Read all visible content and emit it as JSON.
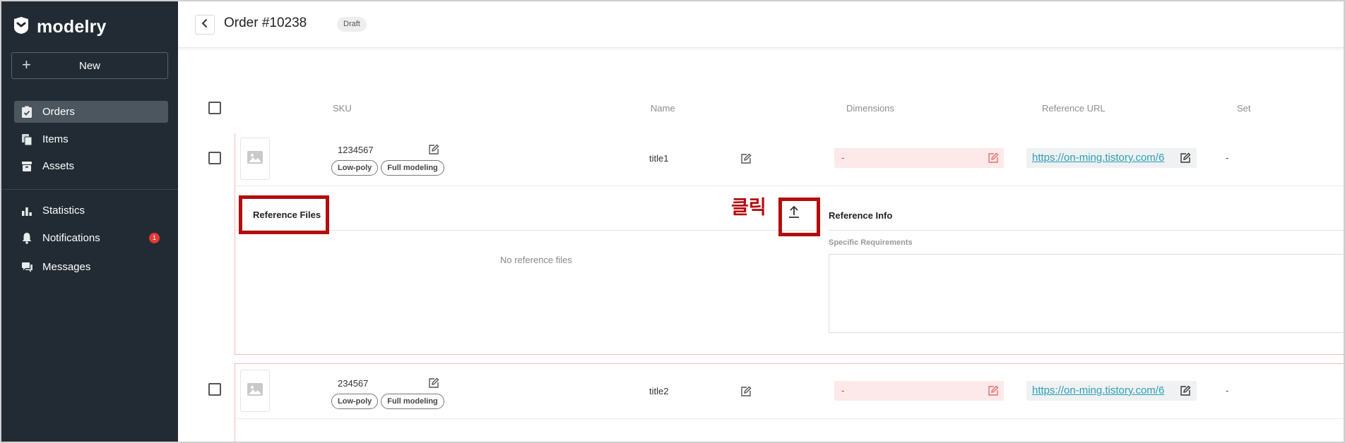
{
  "app": {
    "name": "modelry"
  },
  "sidebar": {
    "new_label": "New",
    "items": [
      {
        "label": "Orders",
        "icon": "orders-icon",
        "active": true
      },
      {
        "label": "Items",
        "icon": "items-icon"
      },
      {
        "label": "Assets",
        "icon": "assets-icon"
      },
      {
        "label": "Statistics",
        "icon": "statistics-icon"
      },
      {
        "label": "Notifications",
        "icon": "bell-icon",
        "badge": "1"
      },
      {
        "label": "Messages",
        "icon": "messages-icon"
      }
    ]
  },
  "header": {
    "title": "Order #10238",
    "status": "Draft"
  },
  "table": {
    "columns": [
      "SKU",
      "Name",
      "Dimensions",
      "Reference URL",
      "Set"
    ],
    "rows": [
      {
        "sku": "1234567",
        "tags": [
          "Low-poly",
          "Full modeling"
        ],
        "name": "title1",
        "dimensions": "-",
        "url": "https://on-ming.tistory.com/6",
        "set": "-"
      },
      {
        "sku": "234567",
        "tags": [
          "Low-poly",
          "Full modeling"
        ],
        "name": "title2",
        "dimensions": "-",
        "url": "https://on-ming.tistory.com/6",
        "set": "-"
      }
    ]
  },
  "expanded": {
    "ref_files_title": "Reference Files",
    "no_files": "No reference files",
    "ref_info_title": "Reference Info",
    "spec_label": "Specific Requirements"
  },
  "annotation": {
    "click_label": "클릭",
    "color": "#b40d0d"
  },
  "colors": {
    "sidebar_bg": "#222b33",
    "link": "#2a9fb7",
    "danger_bg": "#fde9e9",
    "badge": "#e53935"
  }
}
